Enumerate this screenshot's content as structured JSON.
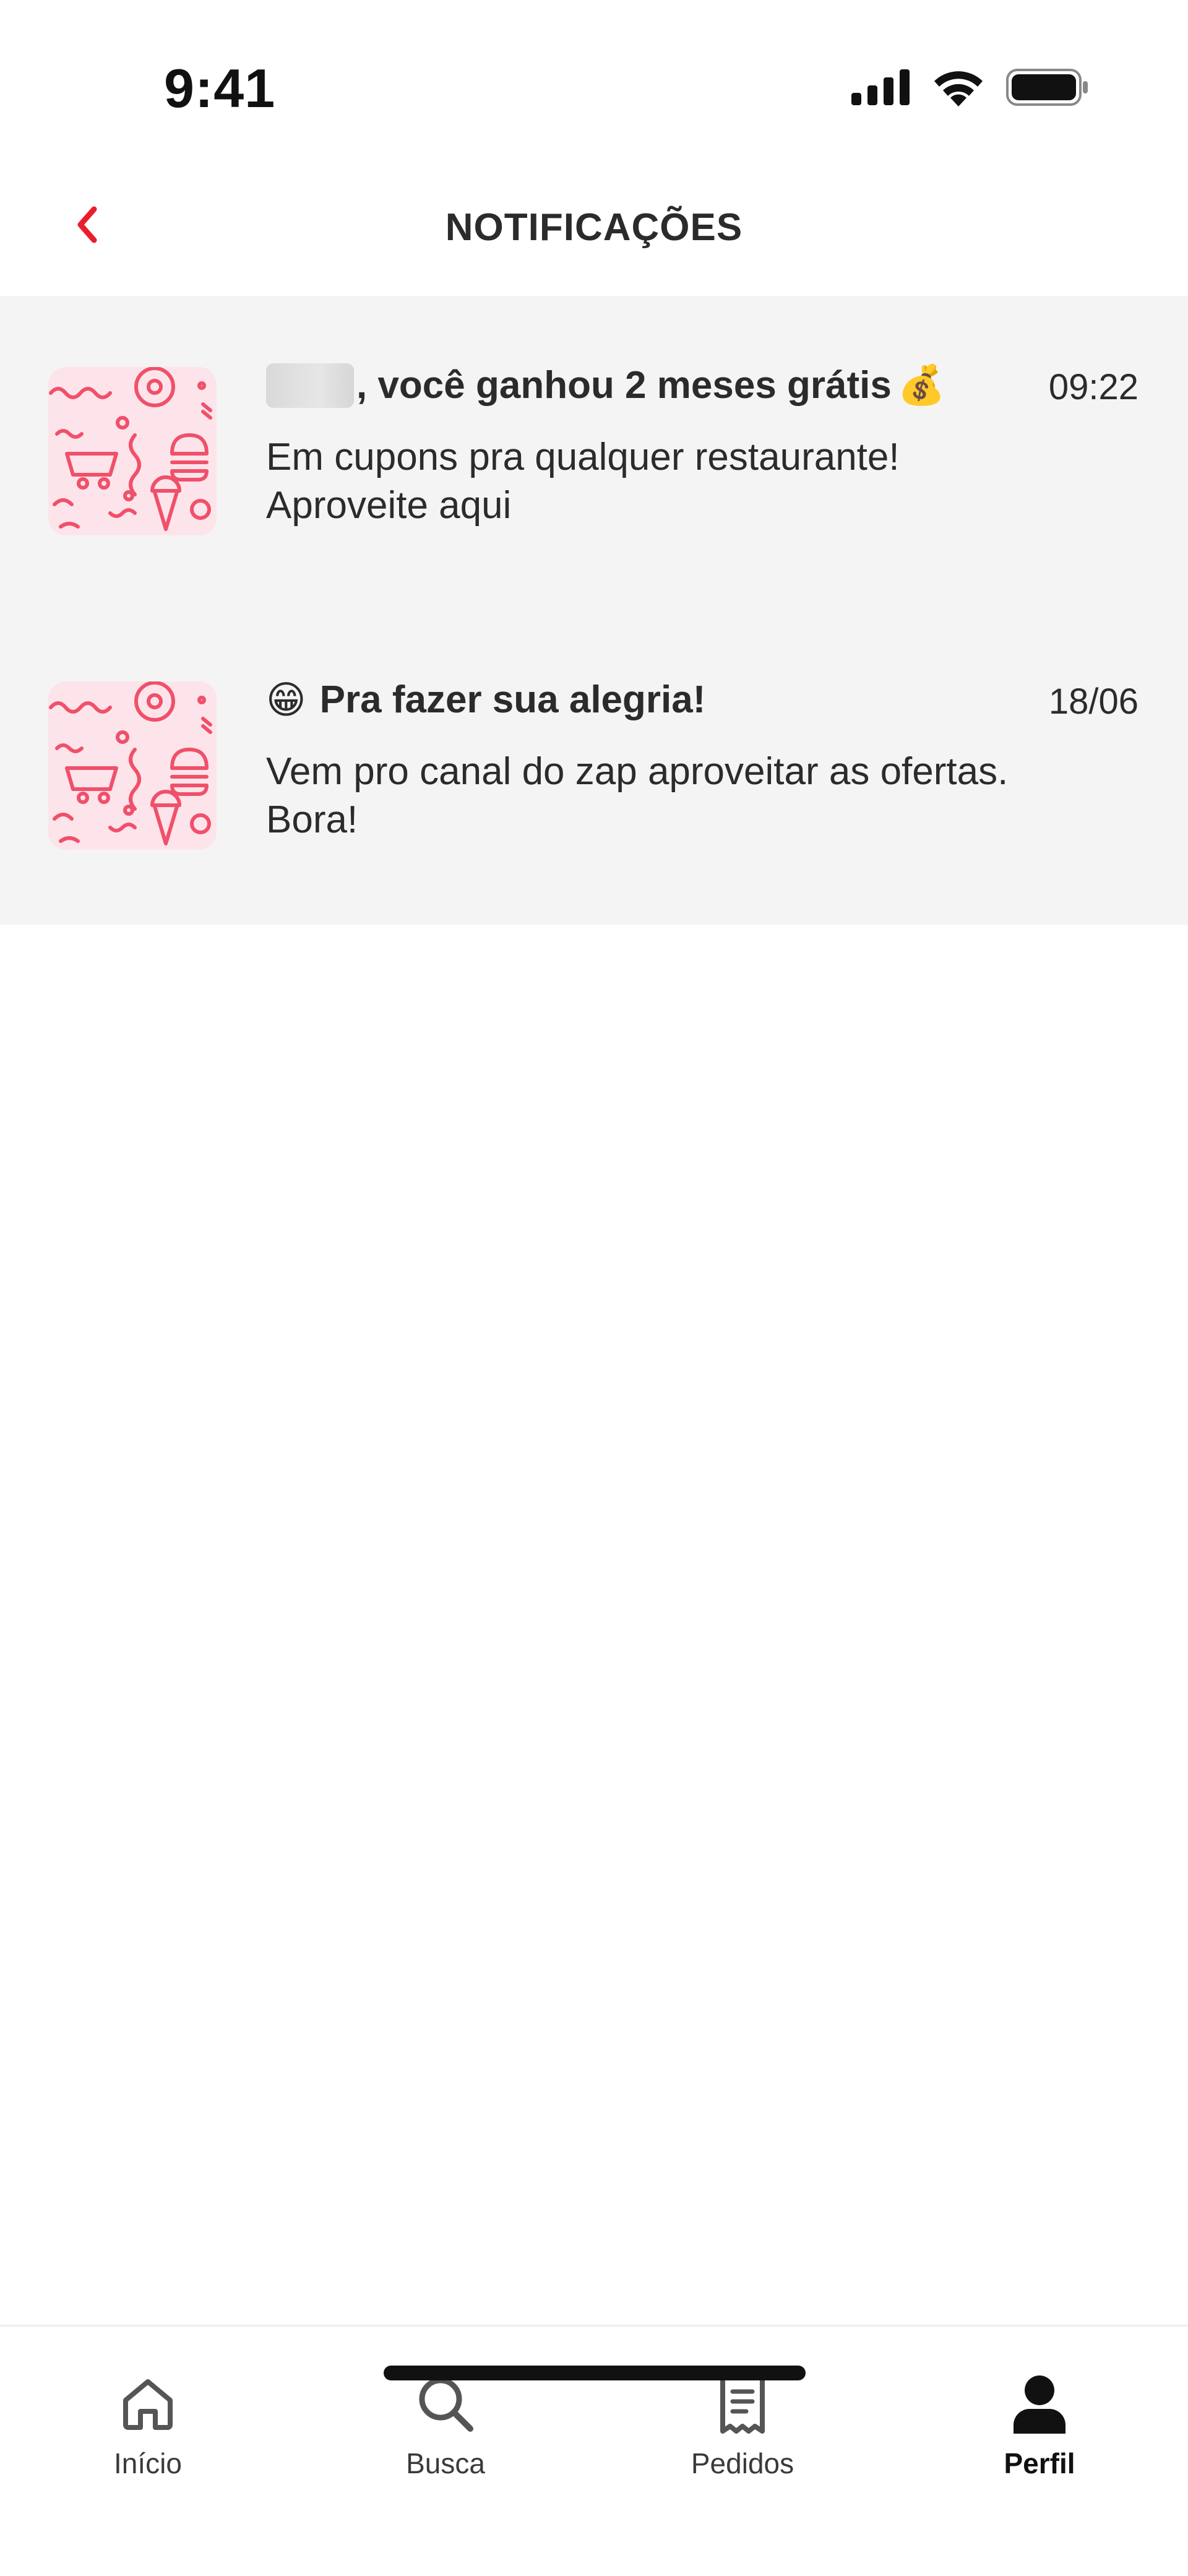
{
  "status_bar": {
    "time": "9:41",
    "icons": [
      "signal-icon",
      "wifi-icon",
      "battery-icon"
    ]
  },
  "header": {
    "title": "NOTIFICAÇÕES",
    "back_icon": "chevron-left-icon"
  },
  "notifications": [
    {
      "title": ", você ganhou 2 meses grátis",
      "title_prefix_redacted": true,
      "title_emoji": "💰",
      "body": "Em cupons pra qualquer restaurante! Aproveite aqui",
      "time": "09:22"
    },
    {
      "title_emoji": "😁",
      "title": "Pra fazer sua alegria!",
      "body": "Vem pro canal do zap aproveitar as ofertas. Bora!",
      "time": "18/06"
    }
  ],
  "tabbar": {
    "items": [
      {
        "label": "Início",
        "icon": "home-icon",
        "active": false
      },
      {
        "label": "Busca",
        "icon": "search-icon",
        "active": false
      },
      {
        "label": "Pedidos",
        "icon": "receipt-icon",
        "active": false
      },
      {
        "label": "Perfil",
        "icon": "profile-icon",
        "active": true
      }
    ]
  },
  "colors": {
    "accent": "#ea1d2c",
    "list_background": "#f4f4f4",
    "thumb_background": "#fde4ea",
    "thumb_pattern": "#f0506a"
  }
}
